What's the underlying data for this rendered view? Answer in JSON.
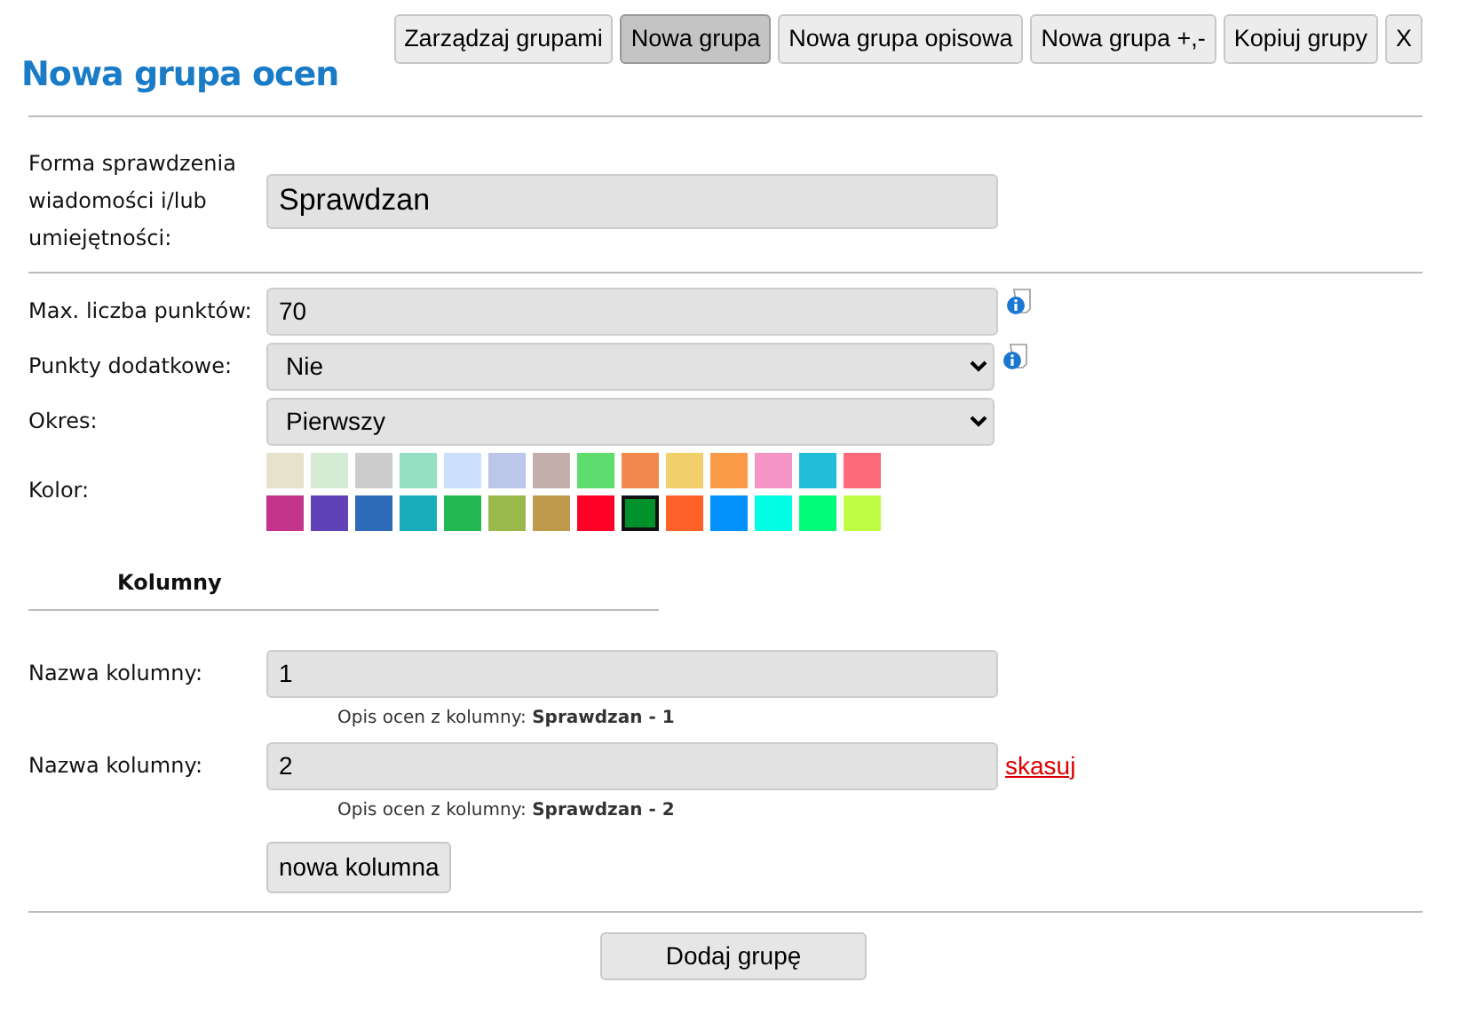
{
  "title": "Nowa grupa ocen",
  "header_buttons": [
    {
      "label": "Zarządzaj grupami",
      "selected": false
    },
    {
      "label": "Nowa grupa",
      "selected": true
    },
    {
      "label": "Nowa grupa opisowa",
      "selected": false
    },
    {
      "label": "Nowa grupa +,-",
      "selected": false
    },
    {
      "label": "Kopiuj grupy",
      "selected": false
    },
    {
      "label": "X",
      "selected": false
    }
  ],
  "form": {
    "label": "Forma sprawdzenia wiadomości i/lub umiejętności:",
    "value": "Sprawdzan"
  },
  "fields": [
    {
      "kind": "input",
      "label": "Max. liczba punktów:",
      "value": "70",
      "info": true
    },
    {
      "kind": "select",
      "label": "Punkty dodatkowe:",
      "value": "Nie",
      "info": true
    },
    {
      "kind": "select",
      "label": "Okres:",
      "value": "Pierwszy",
      "info": false
    }
  ],
  "color_label": "Kolor:",
  "colors": [
    {
      "color": "#e6e3cc",
      "selected": false
    },
    {
      "color": "#d4ecd4",
      "selected": false
    },
    {
      "color": "#cccccc",
      "selected": false
    },
    {
      "color": "#95dfc3",
      "selected": false
    },
    {
      "color": "#cde0fb",
      "selected": false
    },
    {
      "color": "#bcc5ea",
      "selected": false
    },
    {
      "color": "#c4aeab",
      "selected": false
    },
    {
      "color": "#5cdd6d",
      "selected": false
    },
    {
      "color": "#f3884c",
      "selected": false
    },
    {
      "color": "#f1cf6a",
      "selected": false
    },
    {
      "color": "#fc9b47",
      "selected": false
    },
    {
      "color": "#f495c5",
      "selected": false
    },
    {
      "color": "#20bed9",
      "selected": false
    },
    {
      "color": "#fd6a79",
      "selected": false
    },
    {
      "color": "#c4338c",
      "selected": false
    },
    {
      "color": "#6141b7",
      "selected": false
    },
    {
      "color": "#2d6ab7",
      "selected": false
    },
    {
      "color": "#18acbb",
      "selected": false
    },
    {
      "color": "#23b852",
      "selected": false
    },
    {
      "color": "#99b94d",
      "selected": false
    },
    {
      "color": "#bf9a4b",
      "selected": false
    },
    {
      "color": "#ff0026",
      "selected": false
    },
    {
      "color": "#00922a",
      "selected": true
    },
    {
      "color": "#ff6129",
      "selected": false
    },
    {
      "color": "#0391fc",
      "selected": false
    },
    {
      "color": "#01fde3",
      "selected": false
    },
    {
      "color": "#01fc7c",
      "selected": false
    },
    {
      "color": "#c1fc45",
      "selected": false
    }
  ],
  "columns_heading": "Kolumny",
  "columns": [
    {
      "label": "Nazwa kolumny:",
      "value": "1",
      "description": "Opis ocen z kolumny: **Sprawdzan - 1**"
    },
    {
      "label": "Nazwa kolumny:",
      "value": "2",
      "description": "Opis ocen z kolumny: **Sprawdzan - 2**",
      "delete_link": "skasuj"
    }
  ],
  "add_column_button": "nowa kolumna",
  "submit_button": "Dodaj grupę"
}
